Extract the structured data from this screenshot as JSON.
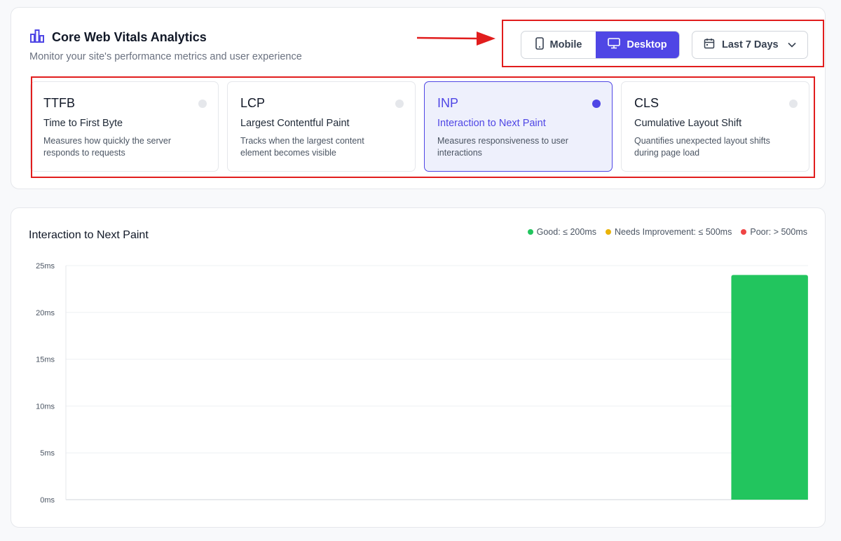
{
  "header": {
    "title": "Core Web Vitals Analytics",
    "subtitle": "Monitor your site's performance metrics and user experience"
  },
  "device_toggle": {
    "options": [
      {
        "label": "Mobile",
        "icon": "smartphone-icon",
        "active": false
      },
      {
        "label": "Desktop",
        "icon": "monitor-icon",
        "active": true
      }
    ]
  },
  "date_range": {
    "label": "Last 7 Days",
    "icon": "calendar-icon"
  },
  "metrics": [
    {
      "abbr": "TTFB",
      "name": "Time to First Byte",
      "desc": "Measures how quickly the server responds to requests",
      "active": false
    },
    {
      "abbr": "LCP",
      "name": "Largest Contentful Paint",
      "desc": "Tracks when the largest content element becomes visible",
      "active": false
    },
    {
      "abbr": "INP",
      "name": "Interaction to Next Paint",
      "desc": "Measures responsiveness to user interactions",
      "active": true
    },
    {
      "abbr": "CLS",
      "name": "Cumulative Layout Shift",
      "desc": "Quantifies unexpected layout shifts during page load",
      "active": false
    }
  ],
  "colors": {
    "accent": "#4f46e5",
    "good": "#22c55e",
    "needs_improvement": "#eab308",
    "poor": "#ef4444",
    "annotation": "#e11d1d"
  },
  "chart_data": {
    "type": "bar",
    "title": "Interaction to Next Paint",
    "legend": [
      {
        "label": "Good: ≤ 200ms",
        "color": "#22c55e"
      },
      {
        "label": "Needs Improvement: ≤ 500ms",
        "color": "#eab308"
      },
      {
        "label": "Poor: > 500ms",
        "color": "#ef4444"
      }
    ],
    "legend_position": "top-right",
    "y_ticks": [
      "0ms",
      "5ms",
      "10ms",
      "15ms",
      "20ms",
      "25ms"
    ],
    "ylim": [
      0,
      25
    ],
    "grid": true,
    "categories": [
      "",
      "",
      "",
      "",
      "",
      "",
      "",
      "",
      ""
    ],
    "values": [
      null,
      null,
      null,
      null,
      null,
      null,
      null,
      null,
      24
    ],
    "bar_color": "#22c55e"
  }
}
